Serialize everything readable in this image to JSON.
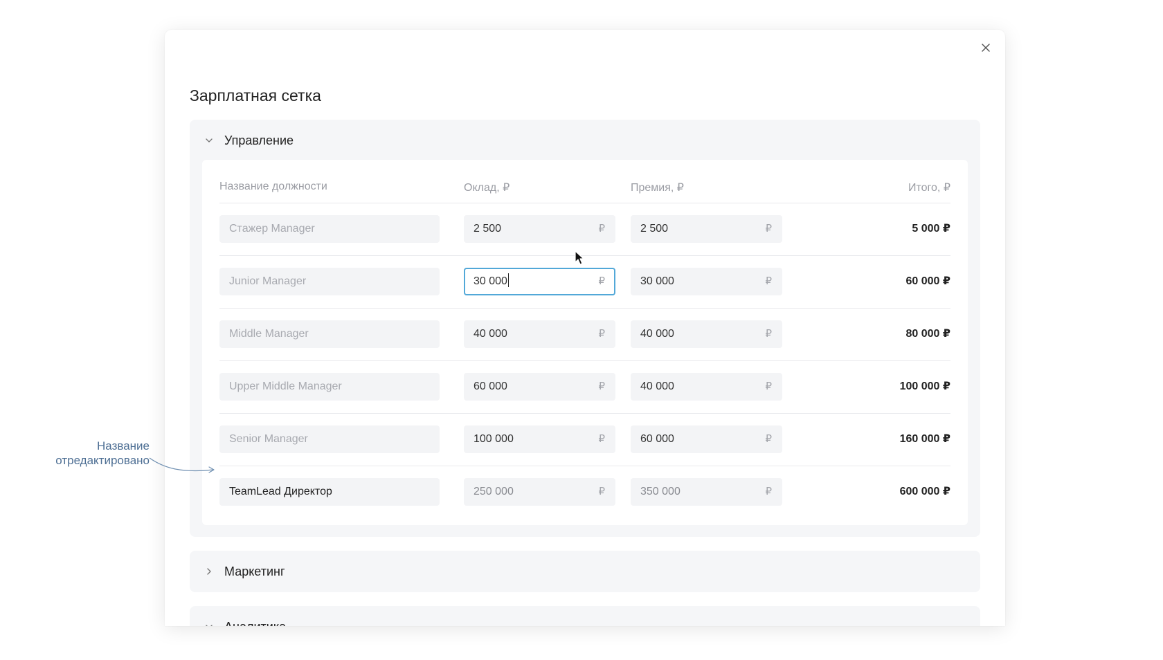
{
  "modal": {
    "title": "Зарплатная сетка"
  },
  "sections": [
    {
      "title": "Управление",
      "expanded": true,
      "columns": {
        "name": "Название должности",
        "salary": "Оклад, ₽",
        "bonus": "Премия, ₽",
        "total": "Итого, ₽"
      },
      "rows": [
        {
          "name": "Стажер Manager",
          "salary": "2 500",
          "bonus": "2 500",
          "total": "5 000 ₽"
        },
        {
          "name": "Junior Manager",
          "salary": "30 000",
          "bonus": "30 000",
          "total": "60 000 ₽"
        },
        {
          "name": "Middle Manager",
          "salary": "40 000",
          "bonus": "40 000",
          "total": "80 000 ₽"
        },
        {
          "name": "Upper Middle Manager",
          "salary": "60 000",
          "bonus": "40 000",
          "total": "100 000 ₽"
        },
        {
          "name": "Senior Manager",
          "salary": "100 000",
          "bonus": "60 000",
          "total": "160 000 ₽"
        },
        {
          "name": "TeamLead Директор",
          "salary": "250 000",
          "bonus": "350 000",
          "total": "600 000 ₽"
        }
      ]
    },
    {
      "title": "Маркетинг",
      "expanded": false
    },
    {
      "title": "Аналитика",
      "expanded": true
    }
  ],
  "currency_symbol": "₽",
  "annotation": {
    "line1": "Название",
    "line2": "отредактировано"
  },
  "colors": {
    "focus_border": "#52a8d8",
    "annotation": "#4e6f94",
    "section_bg": "#f5f6f8"
  },
  "icons": {
    "close": "close-icon",
    "expanded": "chevron-down-icon",
    "collapsed": "chevron-right-icon"
  }
}
